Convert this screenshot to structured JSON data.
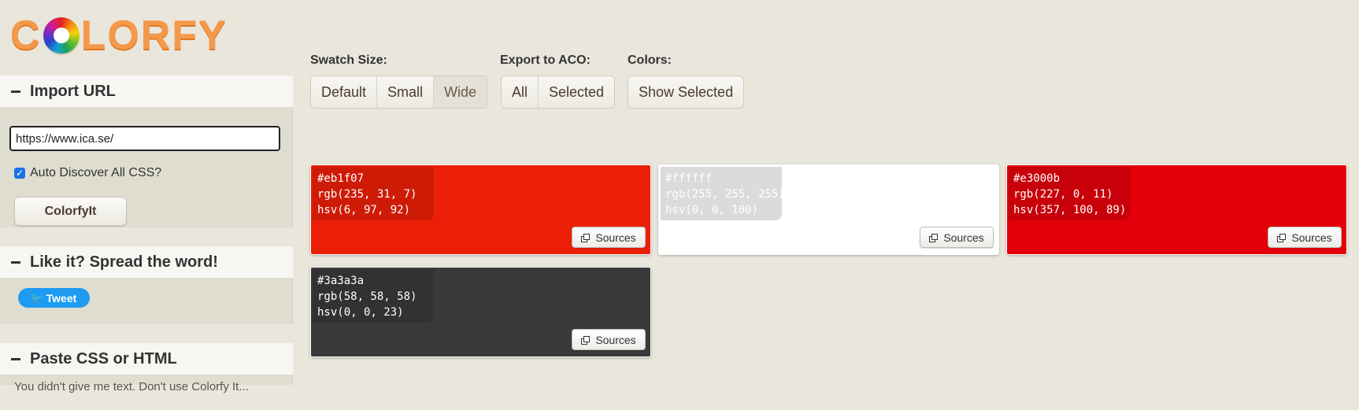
{
  "logo": {
    "text_pre": "C",
    "text_post": "LORFY"
  },
  "sidebar": {
    "import": {
      "title": "Import URL",
      "url_value": "https://www.ica.se/",
      "auto_discover_label": "Auto Discover All CSS?",
      "auto_discover_checked": true,
      "colorfy_button": "ColorfyIt"
    },
    "share": {
      "title": "Like it? Spread the word!",
      "tweet_label": "Tweet"
    },
    "paste": {
      "title": "Paste CSS or HTML",
      "body_partial": "You didn't give me text. Don't use Colorfy It..."
    }
  },
  "toolbar": {
    "swatch_size": {
      "label": "Swatch Size:",
      "options": [
        "Default",
        "Small",
        "Wide"
      ],
      "selected": "Wide"
    },
    "export": {
      "label": "Export to ACO:",
      "options": [
        "All",
        "Selected"
      ]
    },
    "colors": {
      "label": "Colors:",
      "show_selected": "Show Selected"
    }
  },
  "swatches": [
    {
      "hex": "#eb1f07",
      "rgb": "rgb(235, 31, 7)",
      "hsv": "hsv(6, 97, 92)",
      "sources_label": "Sources"
    },
    {
      "hex": "#ffffff",
      "rgb": "rgb(255, 255, 255)",
      "hsv": "hsv(0, 0, 100)",
      "sources_label": "Sources"
    },
    {
      "hex": "#e3000b",
      "rgb": "rgb(227, 0, 11)",
      "hsv": "hsv(357, 100, 89)",
      "sources_label": "Sources"
    },
    {
      "hex": "#3a3a3a",
      "rgb": "rgb(58, 58, 58)",
      "hsv": "hsv(0, 0, 23)",
      "sources_label": "Sources"
    }
  ]
}
